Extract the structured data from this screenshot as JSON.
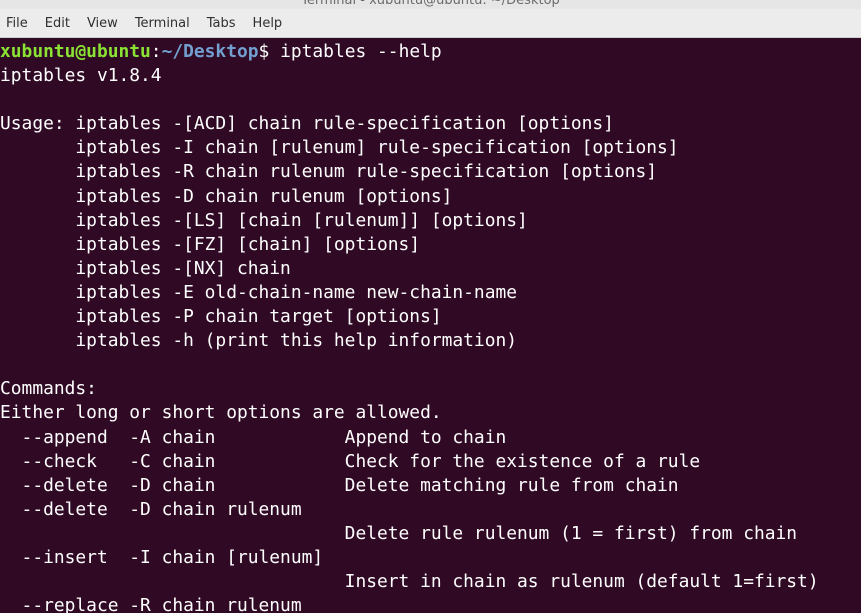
{
  "window": {
    "title": "Terminal - xubuntu@ubuntu: ~/Desktop",
    "controls": "–"
  },
  "menu": [
    "File",
    "Edit",
    "View",
    "Terminal",
    "Tabs",
    "Help"
  ],
  "prompt": {
    "user_host": "xubuntu@ubuntu",
    "colon": ":",
    "path": "~/Desktop",
    "dollar": "$",
    "command": " iptables --help"
  },
  "output": [
    "iptables v1.8.4",
    "",
    "Usage: iptables -[ACD] chain rule-specification [options]",
    "       iptables -I chain [rulenum] rule-specification [options]",
    "       iptables -R chain rulenum rule-specification [options]",
    "       iptables -D chain rulenum [options]",
    "       iptables -[LS] [chain [rulenum]] [options]",
    "       iptables -[FZ] [chain] [options]",
    "       iptables -[NX] chain",
    "       iptables -E old-chain-name new-chain-name",
    "       iptables -P chain target [options]",
    "       iptables -h (print this help information)",
    "",
    "Commands:",
    "Either long or short options are allowed.",
    "  --append  -A chain            Append to chain",
    "  --check   -C chain            Check for the existence of a rule",
    "  --delete  -D chain            Delete matching rule from chain",
    "  --delete  -D chain rulenum",
    "                                Delete rule rulenum (1 = first) from chain",
    "  --insert  -I chain [rulenum]",
    "                                Insert in chain as rulenum (default 1=first)",
    "  --replace -R chain rulenum"
  ]
}
